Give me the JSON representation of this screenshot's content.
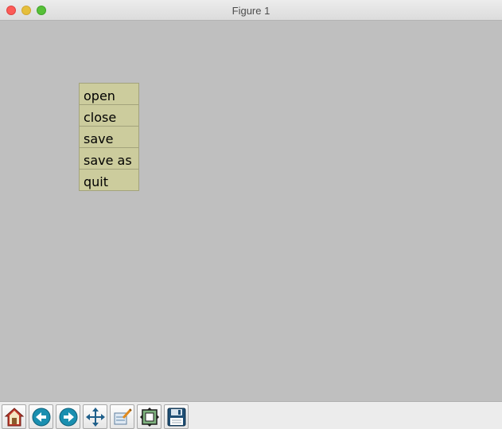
{
  "window": {
    "title": "Figure 1"
  },
  "menu": {
    "items": [
      {
        "label": "open"
      },
      {
        "label": "close"
      },
      {
        "label": "save"
      },
      {
        "label": "save as"
      },
      {
        "label": "quit"
      }
    ],
    "background_color": "#cccc9d",
    "border_color": "#a3a37c"
  },
  "toolbar": {
    "buttons": [
      {
        "icon": "home-icon"
      },
      {
        "icon": "back-arrow-icon"
      },
      {
        "icon": "forward-arrow-icon"
      },
      {
        "icon": "pan-move-icon"
      },
      {
        "icon": "zoom-rectangle-icon"
      },
      {
        "icon": "configure-subplots-icon"
      },
      {
        "icon": "save-floppy-icon"
      }
    ]
  },
  "colors": {
    "canvas": "#bfbfbf",
    "close_button": "#fc5b57",
    "minimize_button": "#e5bf3c",
    "zoom_button": "#57c038"
  }
}
